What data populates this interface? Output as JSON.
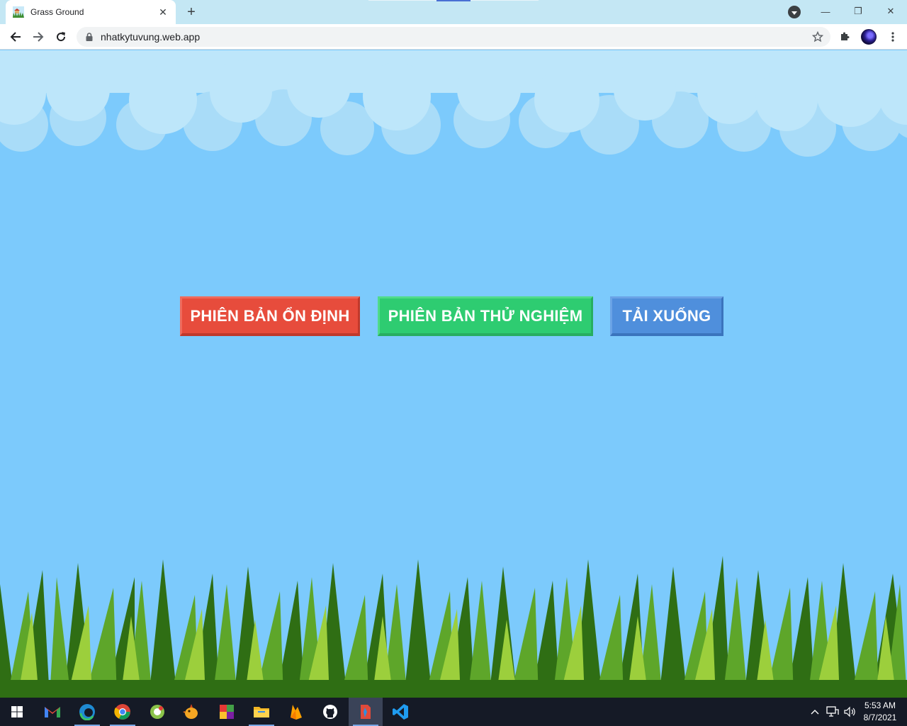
{
  "browser": {
    "tab": {
      "title": "Grass Ground",
      "close_glyph": "✕"
    },
    "new_tab_glyph": "+",
    "window_controls": {
      "minimize": "—",
      "restore": "❐",
      "close": "✕"
    },
    "address": {
      "url": "nhatkytuvung.web.app"
    }
  },
  "page": {
    "buttons": {
      "stable": {
        "label": "PHIÊN BẢN ỔN ĐỊNH",
        "color": "#e74c3c"
      },
      "beta": {
        "label": "PHIÊN BẢN THỬ NGHIỆM",
        "color": "#2ecc71"
      },
      "download": {
        "label": "TẢI XUỐNG",
        "color": "#4f8fdc"
      }
    },
    "sky_color": "#7ccafc"
  },
  "taskbar": {
    "apps": [
      "start-icon",
      "gmail-icon",
      "edge-icon",
      "chrome-icon",
      "app-green-icon",
      "app-chick-icon",
      "app-blocks-icon",
      "file-explorer-icon",
      "firebase-icon",
      "github-icon",
      "app-tool-icon",
      "vscode-icon"
    ],
    "clock": {
      "time": "5:53 AM",
      "date": "8/7/2021"
    }
  }
}
